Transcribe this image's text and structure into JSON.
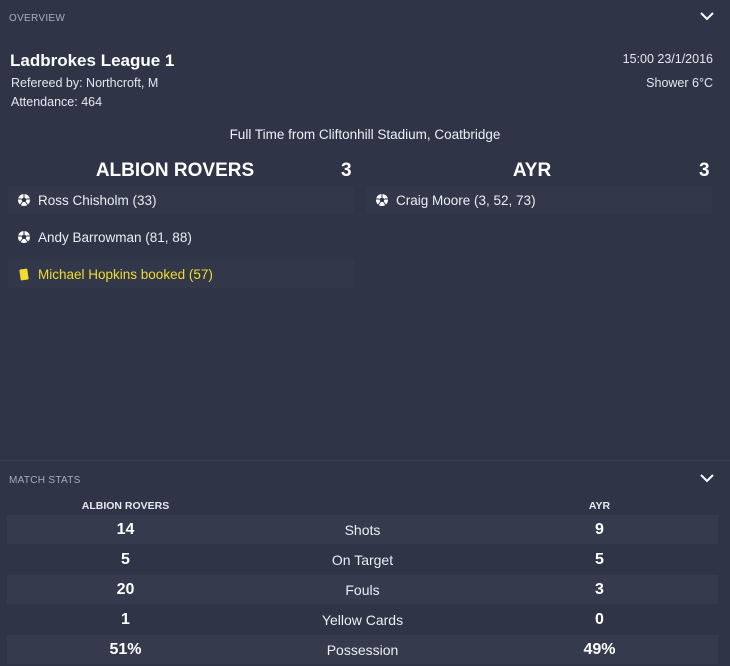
{
  "overview": {
    "section_label": "OVERVIEW",
    "competition": "Ladbrokes League 1",
    "referee": "Refereed by: Northcroft, M",
    "attendance": "Attendance: 464",
    "datetime": "15:00 23/1/2016",
    "weather": "Shower 6°C",
    "result_line": "Full Time from Cliftonhill Stadium, Coatbridge",
    "home": {
      "name": "ALBION ROVERS",
      "score": "3",
      "events": [
        {
          "type": "goal",
          "icon": "football-icon",
          "text": "Ross Chisholm (33)"
        },
        {
          "type": "goal",
          "icon": "football-icon",
          "text": "Andy Barrowman (81, 88)"
        },
        {
          "type": "booking",
          "icon": "yellow-card-icon",
          "text": "Michael Hopkins booked (57)"
        }
      ]
    },
    "away": {
      "name": "AYR",
      "score": "3",
      "events": [
        {
          "type": "goal",
          "icon": "football-icon",
          "text": "Craig Moore (3, 52, 73)"
        }
      ]
    }
  },
  "match_stats": {
    "section_label": "MATCH STATS",
    "home_label": "ALBION ROVERS",
    "away_label": "AYR",
    "rows": [
      {
        "label": "Shots",
        "home": "14",
        "away": "9"
      },
      {
        "label": "On Target",
        "home": "5",
        "away": "5"
      },
      {
        "label": "Fouls",
        "home": "20",
        "away": "3"
      },
      {
        "label": "Yellow Cards",
        "home": "1",
        "away": "0"
      },
      {
        "label": "Possession",
        "home": "51%",
        "away": "49%"
      }
    ]
  },
  "colors": {
    "background": "#2e3344",
    "yellow_card": "#f0dd2e"
  }
}
